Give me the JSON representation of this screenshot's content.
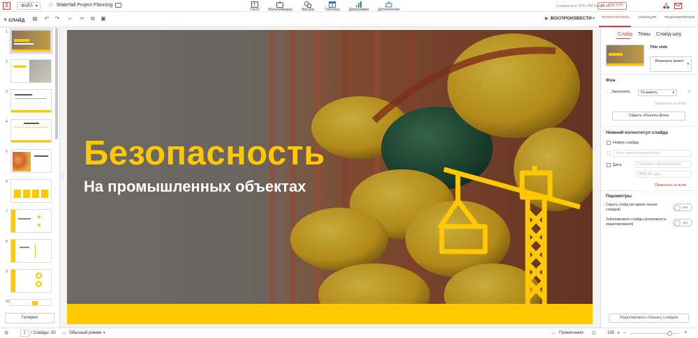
{
  "app": {
    "file_label": "ФАЙЛ",
    "doc_title": "Waterfall Project Planning",
    "saved_status": "Сохранено в 10:51 PM (после п...",
    "access_label": "ДОСТУП"
  },
  "insert_tabs": [
    {
      "label": "Текст",
      "icon": "text-icon"
    },
    {
      "label": "Мультимедиа",
      "icon": "media-icon"
    },
    {
      "label": "Фигура",
      "icon": "shape-icon"
    },
    {
      "label": "Таблица",
      "icon": "table-icon"
    },
    {
      "label": "Диаграмма",
      "icon": "chart-icon"
    },
    {
      "label": "Дополнения",
      "icon": "addons-icon"
    }
  ],
  "right_tabs": [
    "ФОРМАТИРОВАТЬ",
    "АНИМАЦИЯ",
    "РЕЦЕНЗИРОВАНИЕ"
  ],
  "toolbar": {
    "slide_label": "СЛАЙД",
    "play_label": "ВОСПРОИЗВЕСТИ"
  },
  "slides_panel": {
    "numbers": [
      "1",
      "2",
      "3",
      "4",
      "5",
      "6",
      "7",
      "8",
      "9",
      "10"
    ],
    "gallery_label": "Галерея"
  },
  "slide": {
    "title": "Безопасность",
    "subtitle": "На промышленных объектах"
  },
  "format_panel": {
    "tabs": [
      "Слайд",
      "Темы",
      "Слайд-шоу"
    ],
    "layout_name": "Title slide",
    "change_layout_label": "Изменить макет",
    "background_heading": "Фон",
    "fill_label": "Заполнить",
    "fill_value": "По макету",
    "apply_all_label": "Применить ко всем",
    "hide_bg_objects_label": "Скрыть объекты фона",
    "footer_heading": "Нижний колонтитул слайда",
    "slide_number_label": "Номер слайда",
    "footer_text_placeholder": "Текст нижнего колонтитула",
    "date_label": "Дата",
    "date_placeholder": "Обновлять автоматически",
    "date_value": "MMM dd, yyyy",
    "apply_all_label_2": "Применить ко всем",
    "params_heading": "Параметры",
    "hide_slide_label": "Скрыть слайд (во время показа слайдов)",
    "lock_slide_label": "Заблокировать слайды (возможность редактирования)",
    "toggle_off": "Нет",
    "edit_master_label": "Редактировать образец слайдов"
  },
  "status": {
    "current_slide": "1",
    "slides_total": "/ Слайды: 20",
    "view_mode": "Обычный режим",
    "notes_label": "Примечания",
    "zoom": "130"
  },
  "colors": {
    "accent": "#d23c2f",
    "slide_yellow": "#ffc800"
  }
}
